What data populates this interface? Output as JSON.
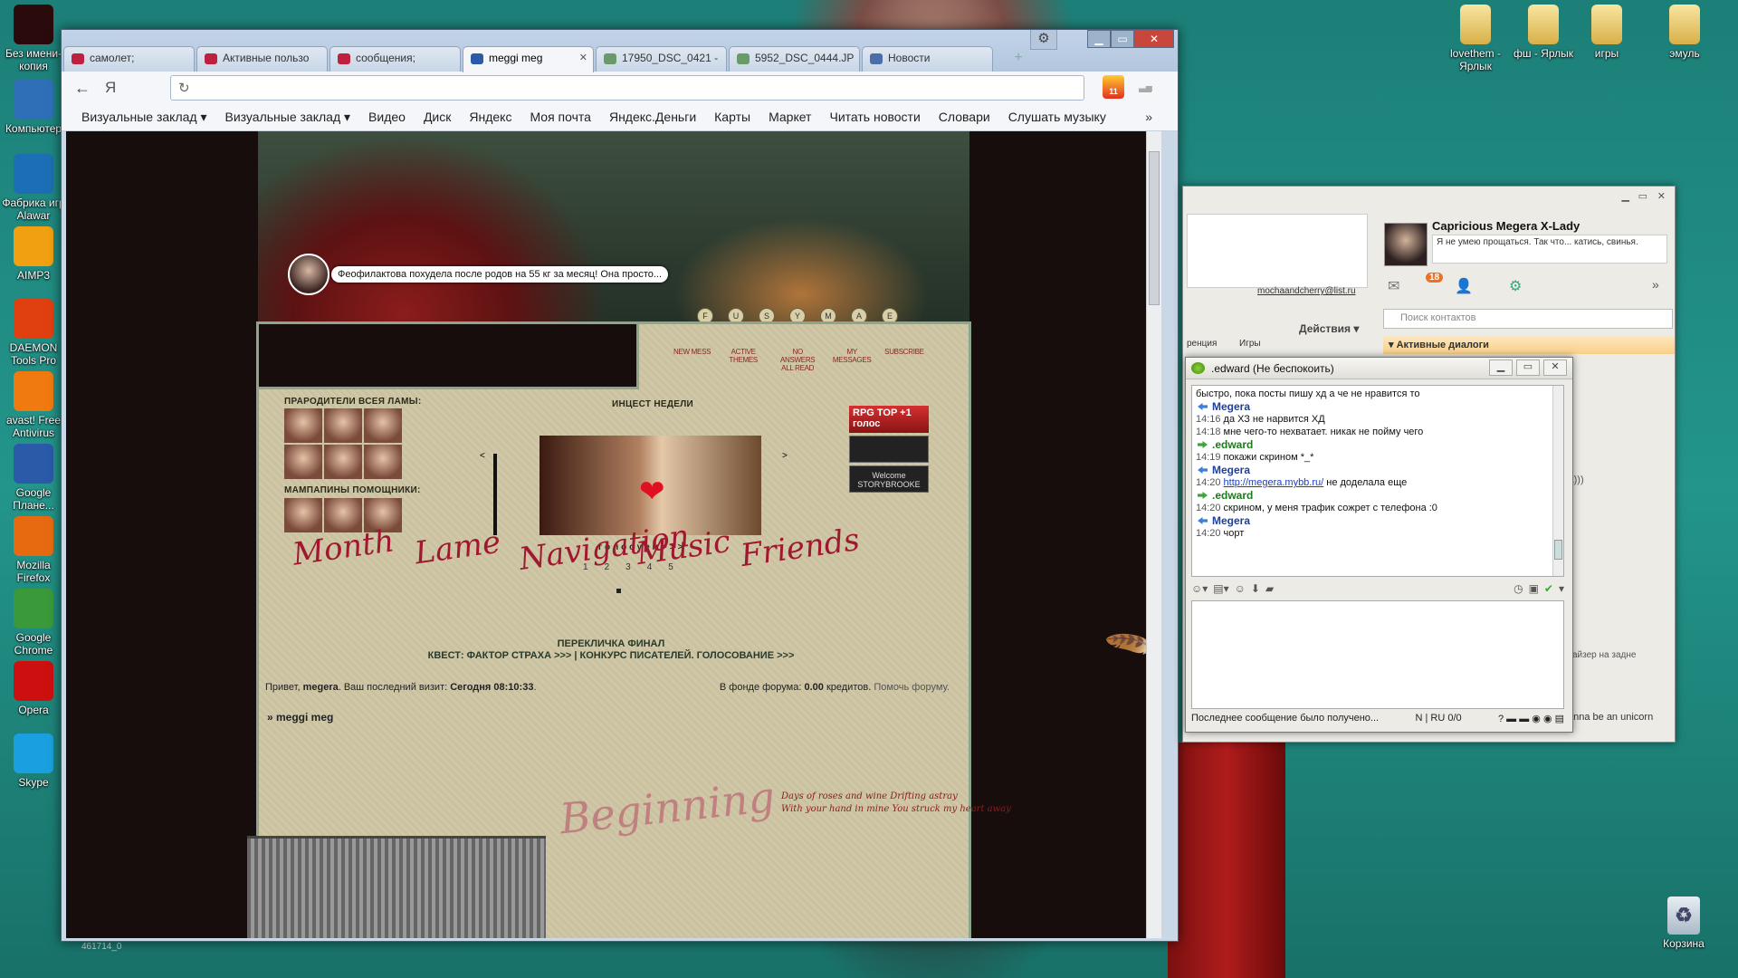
{
  "desktop": {
    "left_icons": [
      {
        "label": "Без имени-копия",
        "icon": "image-file-icon",
        "color": "#2a0a0a"
      },
      {
        "label": "Компьютер",
        "icon": "computer-icon",
        "color": "#2f6fb8"
      },
      {
        "label": "Фабрика игр Alawar",
        "icon": "wordpress-icon",
        "color": "#1c6fb4"
      },
      {
        "label": "AIMP3",
        "icon": "aimp-icon",
        "color": "#f0a010"
      },
      {
        "label": "DAEMON Tools Pro",
        "icon": "daemon-icon",
        "color": "#e04010"
      },
      {
        "label": "avast! Free Antivirus",
        "icon": "avast-icon",
        "color": "#f07a10"
      },
      {
        "label": "Google Плане...",
        "icon": "google-earth-icon",
        "color": "#2a5aa8"
      },
      {
        "label": "Mozilla Firefox",
        "icon": "firefox-icon",
        "color": "#e86a10"
      },
      {
        "label": "Google Chrome",
        "icon": "chrome-icon",
        "color": "#3a9a3a"
      },
      {
        "label": "Opera",
        "icon": "opera-icon",
        "color": "#cc1010"
      },
      {
        "label": "Skype",
        "icon": "skype-icon",
        "color": "#1aa0e0"
      }
    ],
    "right_icons": [
      {
        "label": "lovethem - Ярлык",
        "icon": "folder-shortcut-icon"
      },
      {
        "label": "фш - Ярлык",
        "icon": "folder-shortcut-icon"
      },
      {
        "label": "игры",
        "icon": "folder-icon"
      },
      {
        "label": "эмуль",
        "icon": "folder-icon"
      }
    ],
    "recycle_label": "Корзина",
    "taskbar_id": "461714_0"
  },
  "browser": {
    "tabs": [
      {
        "label": "самолет;",
        "fav_color": "#c02040",
        "active": false
      },
      {
        "label": "Активные пользо",
        "fav_color": "#c02040",
        "active": false
      },
      {
        "label": "сообщения;",
        "fav_color": "#c02040",
        "active": false
      },
      {
        "label": "meggi meg",
        "fav_color": "#2a5aa8",
        "active": true
      },
      {
        "label": "17950_DSC_0421 -",
        "fav_color": "#6a9a6a",
        "active": false
      },
      {
        "label": "5952_DSC_0444.JP",
        "fav_color": "#6a9a6a",
        "active": false
      },
      {
        "label": "Новости",
        "fav_color": "#4a6ea8",
        "active": false
      }
    ],
    "url": "",
    "back_label": "←",
    "ya_label": "Я",
    "notif_count": "11",
    "bookmarks": [
      "Визуальные заклад ▾",
      "Визуальные заклад ▾",
      "Видео",
      "Диск",
      "Яндекс",
      "Моя почта",
      "Яндекс.Деньги",
      "Карты",
      "Маркет",
      "Читать новости",
      "Словари",
      "Слушать музыку"
    ],
    "more_label": "»"
  },
  "forum": {
    "bubble_text": "Феофилактова похудела после родов на 55 кг за месяц! Она просто...",
    "letters": [
      "F",
      "U",
      "S",
      "Y",
      "M",
      "A",
      "E"
    ],
    "mini_links": [
      "NEW MESS",
      "ACTIVE THEMES",
      "NO ANSWERS ALL READ",
      "MY MESSAGES",
      "SUBSCRIBE"
    ],
    "ancestors_title": "ПРАРОДИТЕЛИ ВСЕЯ ЛАМЫ:",
    "helpers_title": "МАМПАПИНЫ ПОМОЩНИКИ:",
    "incest_title": "ИНЦЕСТ НЕДЕЛИ",
    "vote_label": "голосуем>>>",
    "pager": [
      "1",
      "2",
      "3",
      "4",
      "5"
    ],
    "arrow_left": "<",
    "arrow_right": ">",
    "rpg_top": "RPG TOP +1 голос",
    "storybrooke": "Welcome STORYBROOKE",
    "nav_words": [
      "Month",
      "Lame",
      "Navigation",
      "Music",
      "Friends"
    ],
    "finale": "ПЕРЕКЛИЧКА ФИНАЛ",
    "quest": "КВЕСТ: ФАКТОР СТРАХА >>> | КОНКУРС ПИСАТЕЛЕЙ. ГОЛОСОВАНИЕ >>>",
    "greeting_prefix": "Привет,",
    "username": "megera",
    "last_visit_label": ". Ваш последний визит:",
    "last_visit": "Сегодня 08:10:33",
    "fund_label": "В фонде форума:",
    "fund_value": "0.00",
    "fund_suffix": "кредитов.",
    "help_link": "Помочь форуму.",
    "breadcrumb": "» meggi meg",
    "beginning": "Beginning",
    "poem_line1": "Days of roses and wine Drifting astray",
    "poem_line2": "With your hand in mine You struck my heart away"
  },
  "qip": {
    "name": "Capricious Megera X-Lady",
    "status": "Я не умею прощаться. Так что... катись, свинья.",
    "badge": "18",
    "email": "mochaandcherry@list.ru",
    "actions": "Действия ▾",
    "tabs": [
      "ренция",
      "Игры"
    ],
    "search_placeholder": "Поиск контактов",
    "active_dialogs": "▾ Активные диалоги",
    "side_smile": "са)))",
    "side_text": "айзер на задне",
    "unicorn": "anna be an unicorn"
  },
  "chat": {
    "title": ".edward (Не беспокоить)",
    "messages": [
      {
        "type": "text",
        "text": "быстро, пока посты пишу хд а че не нравится то"
      },
      {
        "type": "who",
        "who": "Megera",
        "cls": "blue"
      },
      {
        "type": "line",
        "time": "14:16",
        "text": "да ХЗ не нарвится ХД"
      },
      {
        "type": "line",
        "time": "14:18",
        "text": "мне чего-то нехватает. никак не пойму чего"
      },
      {
        "type": "who",
        "who": ".edward",
        "cls": "green"
      },
      {
        "type": "line",
        "time": "14:19",
        "text": "покажи скрином *_*"
      },
      {
        "type": "who",
        "who": "Megera",
        "cls": "blue"
      },
      {
        "type": "link",
        "time": "14:20",
        "link": "http://megera.mybb.ru/",
        "text": " не доделала еще"
      },
      {
        "type": "who",
        "who": ".edward",
        "cls": "green"
      },
      {
        "type": "line",
        "time": "14:20",
        "text": "скрином, у меня трафик сожрет с телефона :0"
      },
      {
        "type": "who",
        "who": "Megera",
        "cls": "blue"
      },
      {
        "type": "line",
        "time": "14:20",
        "text": "чорт"
      }
    ],
    "status_left": "Последнее сообщение было получено...",
    "status_mid": "N | RU 0/0"
  }
}
